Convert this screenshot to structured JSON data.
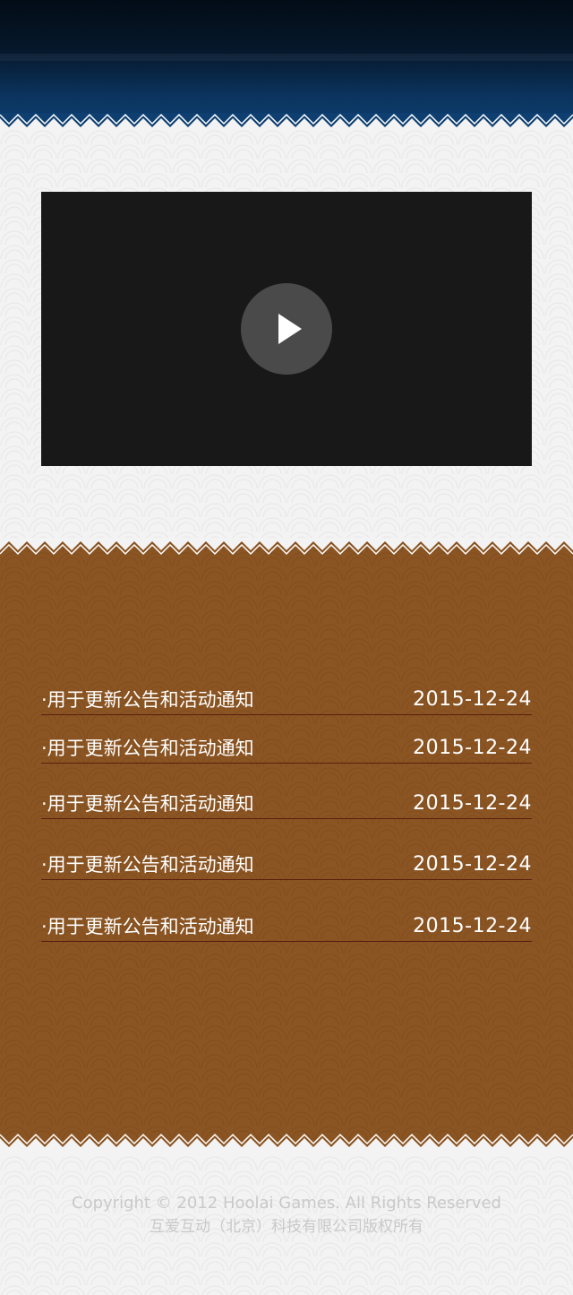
{
  "video": {
    "play_icon": "play-icon"
  },
  "news": {
    "items": [
      {
        "title": "·用于更新公告和活动通知",
        "date": "2015-12-24"
      },
      {
        "title": "·用于更新公告和活动通知",
        "date": "2015-12-24"
      },
      {
        "title": "·用于更新公告和活动通知",
        "date": "2015-12-24"
      },
      {
        "title": "·用于更新公告和活动通知",
        "date": "2015-12-24"
      },
      {
        "title": "·用于更新公告和活动通知",
        "date": "2015-12-24"
      }
    ]
  },
  "footer": {
    "copyright": "Copyright © 2012 Hoolai Games. All Rights Reserved",
    "company": "互爱互动（北京）科技有限公司版权所有"
  },
  "colors": {
    "header_dark": "#020c16",
    "header_blue": "#0e3f70",
    "brown": "#8b5523",
    "divider": "#5a1f10",
    "video_bg": "#181818",
    "play_button": "#4a4a4a",
    "footer_text": "#c9c9c9"
  }
}
